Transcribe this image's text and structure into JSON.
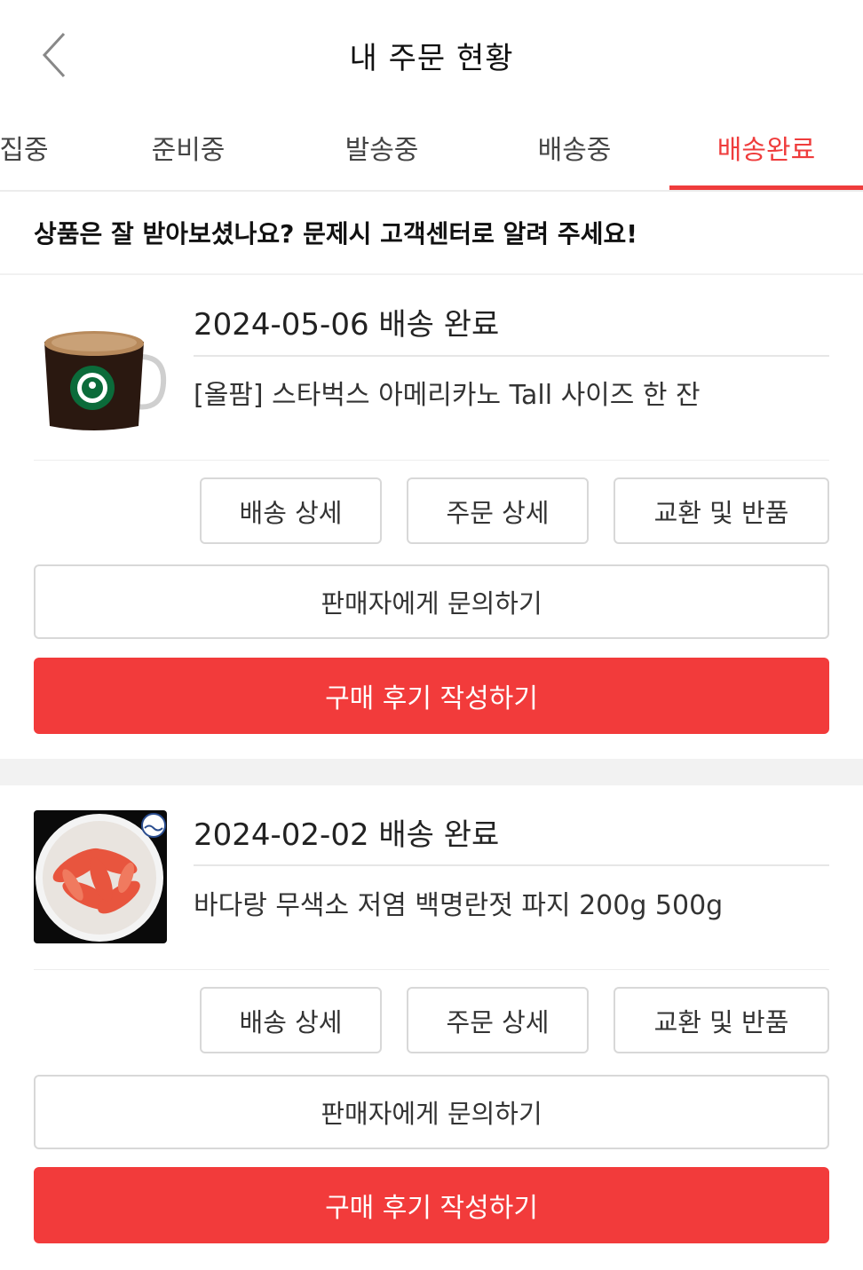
{
  "header": {
    "title": "내 주문 현황",
    "back_icon": "chevron-left-icon"
  },
  "tabs": [
    {
      "label": "집중",
      "active": false
    },
    {
      "label": "준비중",
      "active": false
    },
    {
      "label": "발송중",
      "active": false
    },
    {
      "label": "배송중",
      "active": false
    },
    {
      "label": "배송완료",
      "active": true
    }
  ],
  "colors": {
    "accent": "#ef3c3c",
    "review_button": "#f23b3b"
  },
  "notice": "상품은 잘 받아보셨나요? 문제시 고객센터로 알려 주세요!",
  "orders": [
    {
      "date_status": "2024-05-06 배송 완료",
      "product": "[올팜] 스타벅스 아메리카노 Tall 사이즈 한 잔",
      "thumbnail_icon": "coffee-mug-thumbnail",
      "buttons": {
        "delivery_detail": "배송 상세",
        "order_detail": "주문 상세",
        "exchange_return": "교환 및 반품",
        "contact_seller": "판매자에게 문의하기",
        "write_review": "구매 후기 작성하기"
      }
    },
    {
      "date_status": "2024-02-02 배송 완료",
      "product": "바다랑 무색소 저염 백명란젓 파지 200g 500g",
      "thumbnail_icon": "pollock-roe-thumbnail",
      "buttons": {
        "delivery_detail": "배송 상세",
        "order_detail": "주문 상세",
        "exchange_return": "교환 및 반품",
        "contact_seller": "판매자에게 문의하기",
        "write_review": "구매 후기 작성하기"
      }
    }
  ]
}
